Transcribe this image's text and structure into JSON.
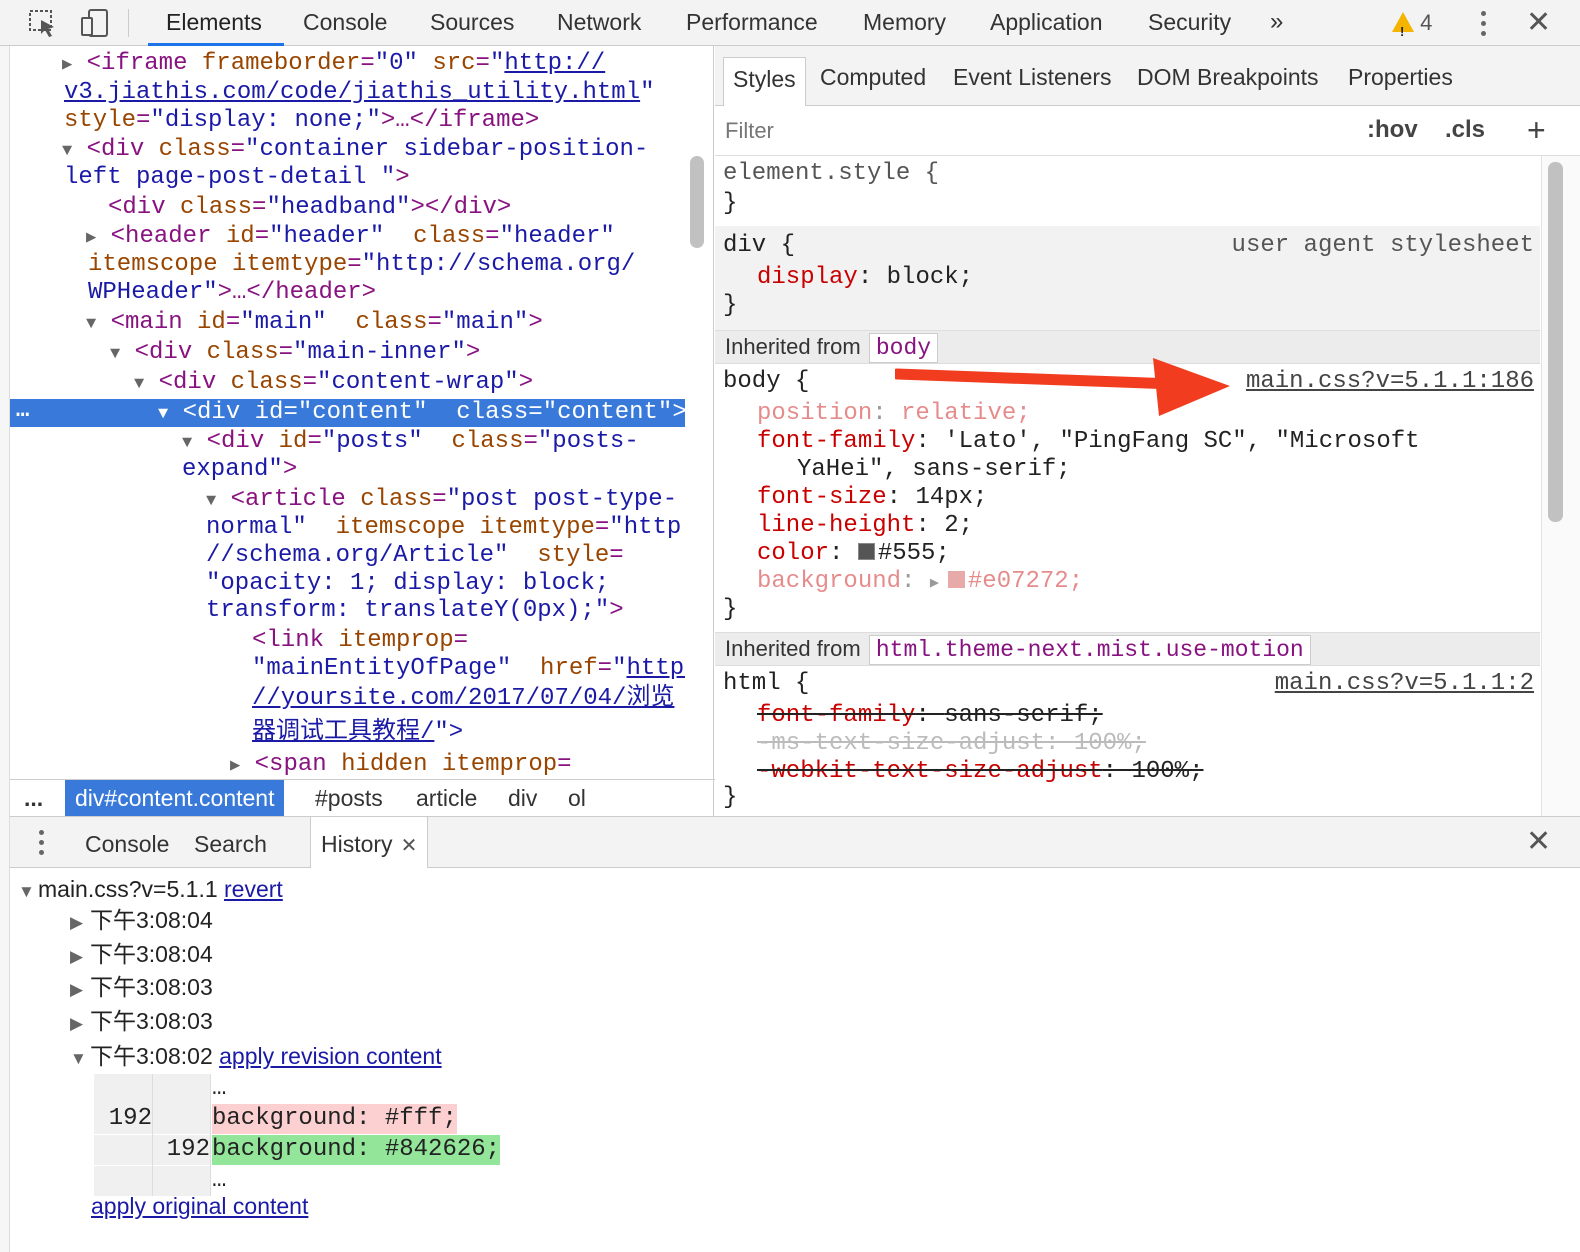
{
  "toolbar": {
    "tabs": [
      "Elements",
      "Console",
      "Sources",
      "Network",
      "Performance",
      "Memory",
      "Application",
      "Security"
    ],
    "more": "»",
    "warnings_count": "4",
    "warning_glyph": "!",
    "close": "✕"
  },
  "dom": {
    "lines": {
      "l1_tag": "<iframe",
      "l1_a1": " frameborder",
      "l1_v1": "\"0\"",
      "l1_a2": " src",
      "l1_v2": "\"",
      "l1_link1": "http://",
      "l2_link": "v3.jiathis.com/code/jiathis_utility.html",
      "l2_q": "\"",
      "l3_a": "style",
      "l3_v": "\"display: none;\"",
      "l3_tail": ">…</iframe>",
      "l4_tag": "<div",
      "l4_a": " class",
      "l4_v": "\"container sidebar-position-",
      "l5_v": "left page-post-detail \"",
      "l5_tail": ">",
      "l6_tag": "<div",
      "l6_a": " class",
      "l6_v": "\"headband\"",
      "l6_tail": "></div>",
      "l7_tag": "<header",
      "l7_a1": " id",
      "l7_v1": "\"header\"",
      "l7_a2": "  class",
      "l7_v2": "\"header\"",
      "l8_a": "itemscope",
      "l8_a2": " itemtype",
      "l8_v": "\"http://schema.org/",
      "l9_v": "WPHeader\"",
      "l9_tail": ">…</header>",
      "l10_tag": "<main",
      "l10_a1": " id",
      "l10_v1": "\"main\"",
      "l10_a2": "  class",
      "l10_v2": "\"main\"",
      "l10_tail": ">",
      "l11_tag": "<div",
      "l11_a": " class",
      "l11_v": "\"main-inner\"",
      "l11_tail": ">",
      "l12_tag": "<div",
      "l12_a": " class",
      "l12_v": "\"content-wrap\"",
      "l12_tail": ">",
      "l13_dots": "…",
      "l13_tag": "<div",
      "l13_a1": " id",
      "l13_v1": "\"content\"",
      "l13_a2": "  class",
      "l13_v2": "\"content\"",
      "l13_tail": ">",
      "l14_tag": "<div",
      "l14_a1": " id",
      "l14_v1": "\"posts\"",
      "l14_a2": "  class",
      "l14_v2": "\"posts-",
      "l15_v": "expand\"",
      "l15_tail": ">",
      "l16_tag": "<article",
      "l16_a": " class",
      "l16_v": "\"post post-type-",
      "l17_v": "normal\"",
      "l17_a": "  itemscope",
      "l17_a2": " itemtype",
      "l17_v2": "\"http:",
      "l18_v": "//schema.org/Article\"",
      "l18_a": "  style",
      "l19_v": "\"opacity: 1; display: block;",
      "l20_v": "transform: translateY(0px);\"",
      "l20_tail": ">",
      "l21_tag": "<link",
      "l21_a": " itemprop",
      "l22_v": "\"mainEntityOfPage\"",
      "l22_a": "  href",
      "l22_q": "\"",
      "l22_link": "http:",
      "l23_link": "//yoursite.com/2017/07/04/浏览",
      "l24_link": "器调试工具教程/",
      "l24_tail": "\">",
      "l25_tag": "<span",
      "l25_a": " hidden",
      "l25_a2": " itemprop"
    }
  },
  "breadcrumbs": [
    "...",
    "div#content.content",
    "#posts",
    "article",
    "div",
    "ol"
  ],
  "styles": {
    "tabs": [
      "Styles",
      "Computed",
      "Event Listeners",
      "DOM Breakpoints",
      "Properties"
    ],
    "filter_placeholder": "Filter",
    "hov": ":hov",
    "cls": ".cls",
    "add": "+",
    "element_style_open": "element.style {",
    "close_brace": "}",
    "div_rule": {
      "selector": "div {",
      "source": "user agent stylesheet",
      "prop": "display",
      "value": "block;"
    },
    "inherited_body": {
      "label": "Inherited from",
      "badge": "body",
      "selector": "body {",
      "source": "main.css?v=5.1.1:186",
      "props": [
        {
          "name": "position",
          "value": "relative;"
        },
        {
          "name": "font-family",
          "value": "'Lato', \"PingFang SC\", \"Microsoft"
        },
        {
          "name": "",
          "value": "YaHei\", sans-serif;"
        },
        {
          "name": "font-size",
          "value": "14px;"
        },
        {
          "name": "line-height",
          "value": "2;"
        },
        {
          "name": "color",
          "value": "#555;"
        },
        {
          "name": "background",
          "value": "#e07272;"
        }
      ],
      "color_swatch": "#555555",
      "bg_swatch": "#e8a9a9"
    },
    "inherited_html": {
      "label": "Inherited from",
      "badge": "html.theme-next.mist.use-motion",
      "selector": "html {",
      "source": "main.css?v=5.1.1:2",
      "props": [
        {
          "name": "font-family",
          "value": "sans-serif;"
        },
        {
          "name": "-ms-text-size-adjust",
          "value": "100%;"
        },
        {
          "name": "-webkit-text-size-adjust",
          "value": "100%;"
        }
      ]
    }
  },
  "drawer": {
    "tabs": [
      "Console",
      "Search",
      "History"
    ],
    "close": "✕",
    "tab_close": "✕"
  },
  "history": {
    "file": "main.css?v=5.1.1",
    "revert": "revert",
    "entries": [
      "下午3:08:04",
      "下午3:08:04",
      "下午3:08:03",
      "下午3:08:03",
      "下午3:08:02"
    ],
    "apply_revision": "apply revision content",
    "diff": {
      "ellipsis": "…",
      "old_line": "192",
      "old_text": "background: #fff;",
      "new_line": "192",
      "new_text": "background: #842626;"
    },
    "apply_original": "apply original content"
  },
  "colors": {
    "accent": "#1a73e8",
    "selection": "#3879d9",
    "arrow": "#f23c1f",
    "tag": "#881280",
    "attr": "#994500",
    "value": "#1a1aa6"
  }
}
